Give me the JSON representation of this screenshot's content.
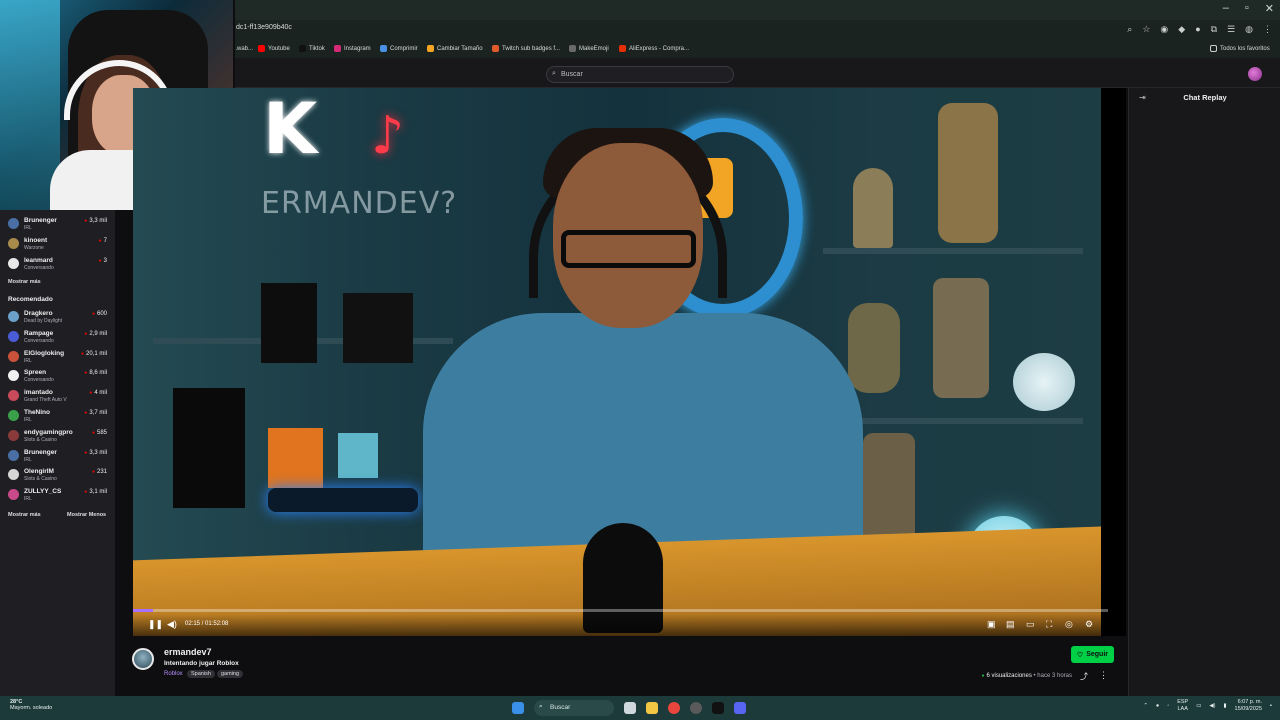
{
  "browser": {
    "url_fragment": "dc1-ff13e909b40c",
    "bookmarks": [
      {
        "label": "...wab...",
        "color": "#4a4a4a"
      },
      {
        "label": "Youtube",
        "color": "#ff0000"
      },
      {
        "label": "Tiktok",
        "color": "#111111"
      },
      {
        "label": "Instagram",
        "color": "#d62976"
      },
      {
        "label": "Comprimir",
        "color": "#4a90e2"
      },
      {
        "label": "Cambiar Tamaño",
        "color": "#f5a623"
      },
      {
        "label": "Twitch sub badges f...",
        "color": "#e05a2a"
      },
      {
        "label": "MakeEmoji",
        "color": "#6a6a6a"
      },
      {
        "label": "AliExpress - Compra...",
        "color": "#e62e04"
      }
    ],
    "favorites_label": "Todos los favoritos"
  },
  "header": {
    "search_placeholder": "Buscar"
  },
  "sidebar": {
    "followed": [
      {
        "name": "Brunenger",
        "game": "IRL",
        "viewers": "3,3 mil",
        "color": "#4a6fa5"
      },
      {
        "name": "kinoent",
        "game": "Warzone",
        "viewers": "7",
        "color": "#a88a4a"
      },
      {
        "name": "leanmard",
        "game": "Conversando",
        "viewers": "3",
        "color": "#e9e9e9"
      }
    ],
    "show_more": "Mostrar más",
    "recommended_title": "Recomendado",
    "recommended": [
      {
        "name": "Dragkero",
        "game": "Dead by Daylight",
        "viewers": "600",
        "color": "#6aa0c9"
      },
      {
        "name": "Rampage",
        "game": "Conversando",
        "viewers": "2,9 mil",
        "color": "#4a5bd6"
      },
      {
        "name": "ElGlogloking",
        "game": "IRL",
        "viewers": "20,1 mil",
        "color": "#c9533a"
      },
      {
        "name": "Spreen",
        "game": "Conversando",
        "viewers": "8,6 mil",
        "color": "#f0f0f0"
      },
      {
        "name": "imantado",
        "game": "Grand Theft Auto V",
        "viewers": "4 mil",
        "color": "#c94a5a"
      },
      {
        "name": "TheNino",
        "game": "IRL",
        "viewers": "3,7 mil",
        "color": "#3aa04a"
      },
      {
        "name": "endygamingpro",
        "game": "Slots & Casino",
        "viewers": "585",
        "color": "#8a3a3a"
      },
      {
        "name": "Brunenger",
        "game": "IRL",
        "viewers": "3,3 mil",
        "color": "#4a6fa5"
      },
      {
        "name": "OlengirlM",
        "game": "Slots & Casino",
        "viewers": "231",
        "color": "#d6d6d6"
      },
      {
        "name": "ZULLYY_CS",
        "game": "IRL",
        "viewers": "3,1 mil",
        "color": "#c94a8a"
      }
    ],
    "show_more2": "Mostrar más",
    "show_less": "Mostrar Menos"
  },
  "player": {
    "neon_text": "ERMANDEV?",
    "time": "02:15 / 01:52:08",
    "progress": 0.02
  },
  "chat": {
    "title": "Chat Replay"
  },
  "info": {
    "channel": "ermandev7",
    "title": "Intentando jugar Roblox",
    "category": "Roblox",
    "tags": [
      "Spanish",
      "gaming"
    ],
    "follow_label": "Seguir",
    "views": "6 visualizaciones",
    "ago": "hace 3 horas"
  },
  "taskbar": {
    "temp": "28°C",
    "weather": "Mayorm. soleado",
    "search": "Buscar",
    "lang1": "ESP",
    "lang2": "LAA",
    "time": "6:07 p. m.",
    "date": "15/09/2025"
  }
}
